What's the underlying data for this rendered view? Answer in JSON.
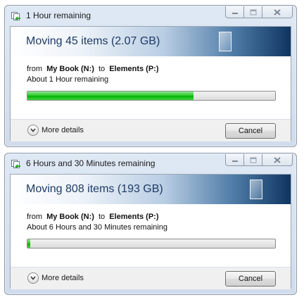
{
  "dialogs": [
    {
      "title": "1 Hour remaining",
      "header": "Moving 45 items (2.07 GB)",
      "from_prefix": "from",
      "source": "My Book (N:)",
      "to_word": "to",
      "destination": "Elements (P:)",
      "status": "About 1 Hour remaining",
      "progress_percent": 67,
      "more_details_label": "More details",
      "cancel_label": "Cancel"
    },
    {
      "title": "6 Hours and 30 Minutes remaining",
      "header": "Moving 808 items (193 GB)",
      "from_prefix": "from",
      "source": "My Book (N:)",
      "to_word": "to",
      "destination": "Elements (P:)",
      "status": "About 6 Hours and 30 Minutes remaining",
      "progress_percent": 1,
      "more_details_label": "More details",
      "cancel_label": "Cancel"
    }
  ],
  "icons": {
    "title": "file-copy-icon",
    "minimize": "minimize-icon",
    "maximize": "maximize-icon",
    "close": "close-icon",
    "more_details": "chevron-down-icon",
    "header_decoration": "document-sheet-icon"
  },
  "colors": {
    "progress_fill": "#06b106",
    "header_band_dark": "#0f3560",
    "header_text": "#1e3a64"
  }
}
